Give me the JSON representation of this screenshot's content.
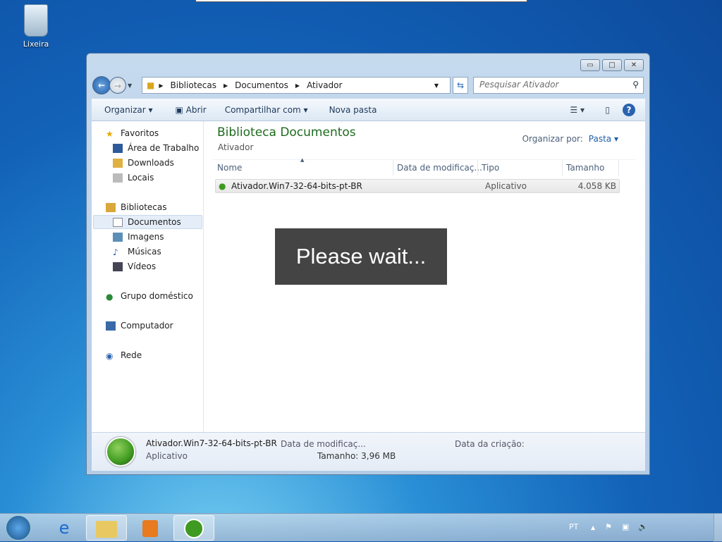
{
  "desktop": {
    "recycle_bin": "Lixeira"
  },
  "window": {
    "address": [
      "Bibliotecas",
      "Documentos",
      "Ativador"
    ],
    "search_placeholder": "Pesquisar Ativador",
    "toolbar": {
      "organize": "Organizar ▾",
      "open": "Abrir",
      "share": "Compartilhar com ▾",
      "new_folder": "Nova pasta"
    },
    "sidebar": {
      "favorites": "Favoritos",
      "desktop": "Área de Trabalho",
      "downloads": "Downloads",
      "places": "Locais",
      "libraries": "Bibliotecas",
      "documents": "Documentos",
      "images": "Imagens",
      "music": "Músicas",
      "videos": "Vídeos",
      "homegroup": "Grupo doméstico",
      "computer": "Computador",
      "network": "Rede"
    },
    "library_title": "Biblioteca Documentos",
    "library_sub": "Ativador",
    "arrange_label": "Organizar por:",
    "arrange_value": "Pasta ▾",
    "columns": {
      "name": "Nome",
      "date": "Data de modificaç...",
      "type": "Tipo",
      "size": "Tamanho"
    },
    "files": [
      {
        "name": "Ativador.Win7-32-64-bits-pt-BR",
        "type": "Aplicativo",
        "size": "4.058 KB"
      }
    ],
    "details": {
      "name": "Ativador.Win7-32-64-bits-pt-BR",
      "type": "Aplicativo",
      "modified_label": "Data de modificaç...",
      "size_label": "Tamanho: 3,96 MB",
      "created_label": "Data da criação:"
    }
  },
  "overlay": {
    "text": "Please wait..."
  },
  "taskbar": {
    "language": "PT"
  }
}
